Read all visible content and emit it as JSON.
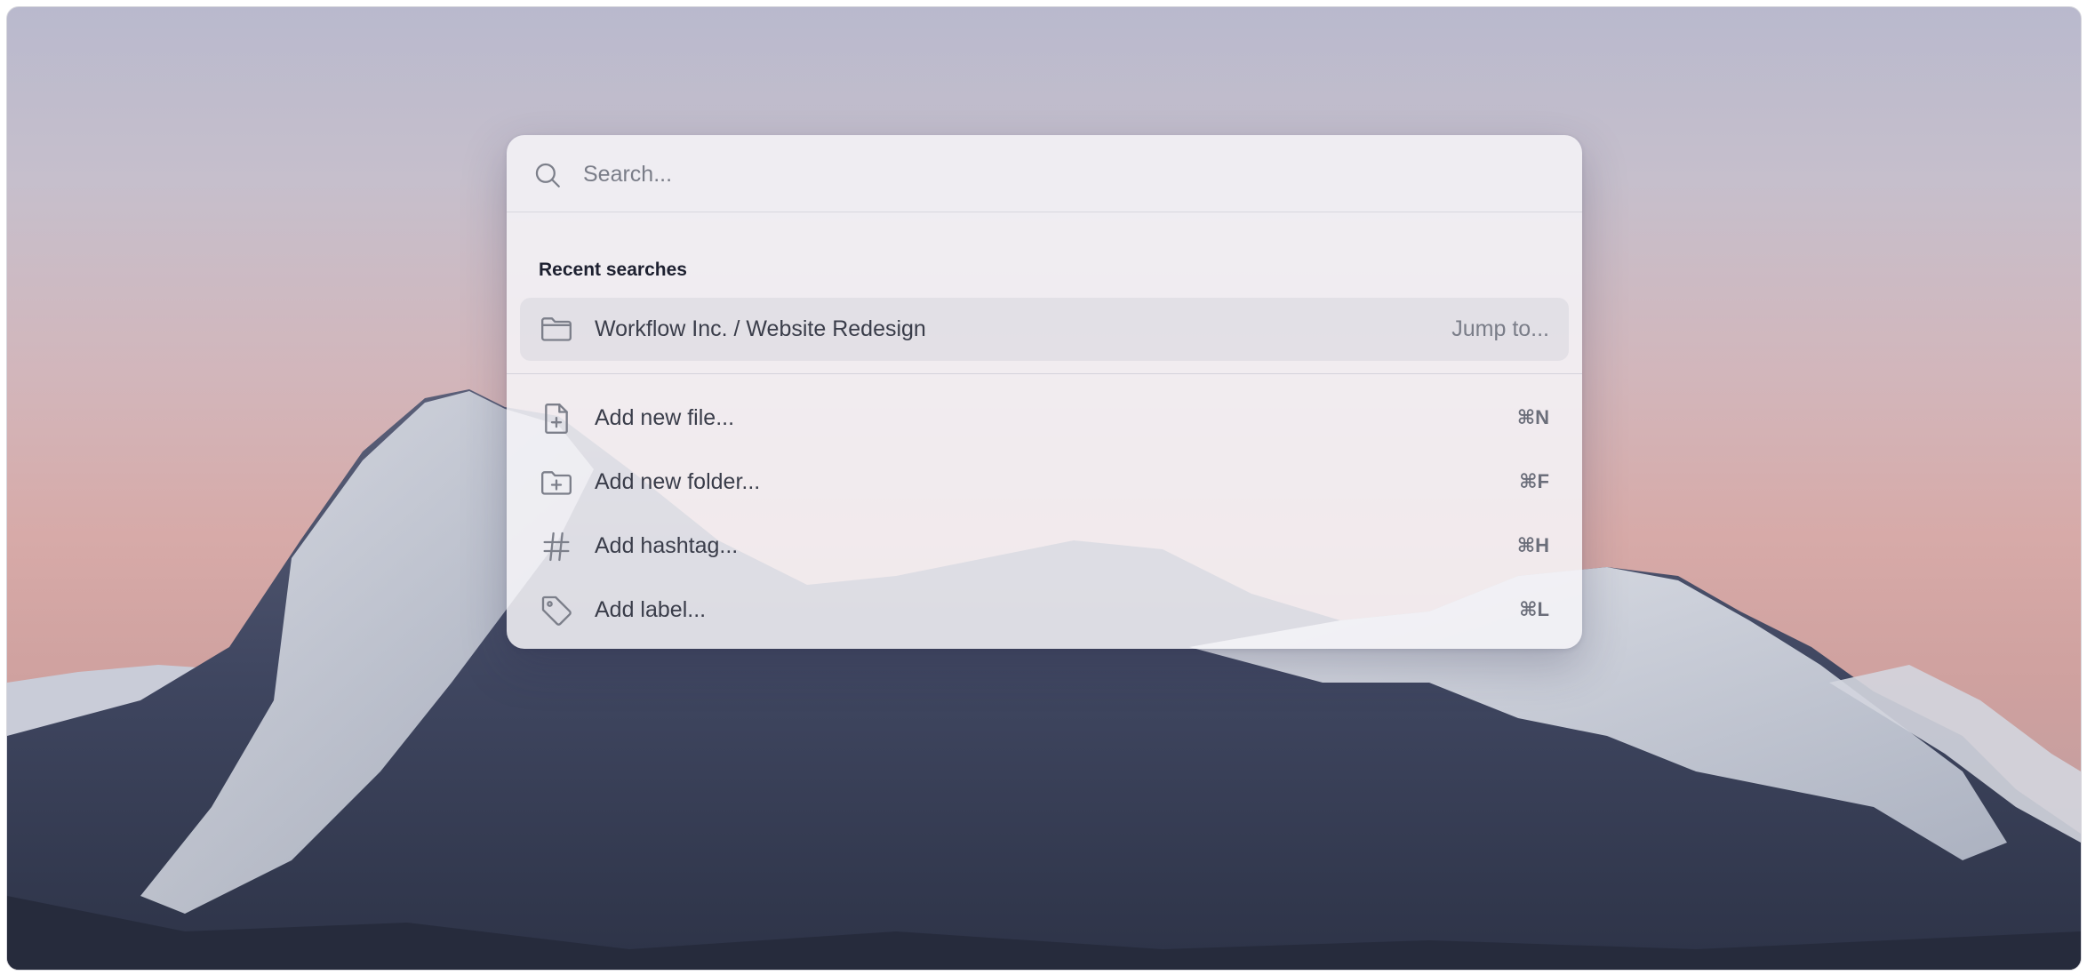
{
  "search": {
    "placeholder": "Search...",
    "value": ""
  },
  "recent": {
    "title": "Recent searches",
    "items": [
      {
        "label": "Workflow Inc. / Website Redesign",
        "hint": "Jump to...",
        "icon": "folder-icon"
      }
    ]
  },
  "actions": [
    {
      "label": "Add new file...",
      "shortcut": "⌘N",
      "icon": "file-plus-icon"
    },
    {
      "label": "Add new folder...",
      "shortcut": "⌘F",
      "icon": "folder-plus-icon"
    },
    {
      "label": "Add hashtag...",
      "shortcut": "⌘H",
      "icon": "hashtag-icon"
    },
    {
      "label": "Add label...",
      "shortcut": "⌘L",
      "icon": "tag-icon"
    }
  ],
  "colors": {
    "text": "#3a3d4a",
    "muted": "#7a7d88",
    "icon": "#7c7f8a",
    "highlight": "#d7d7de"
  }
}
